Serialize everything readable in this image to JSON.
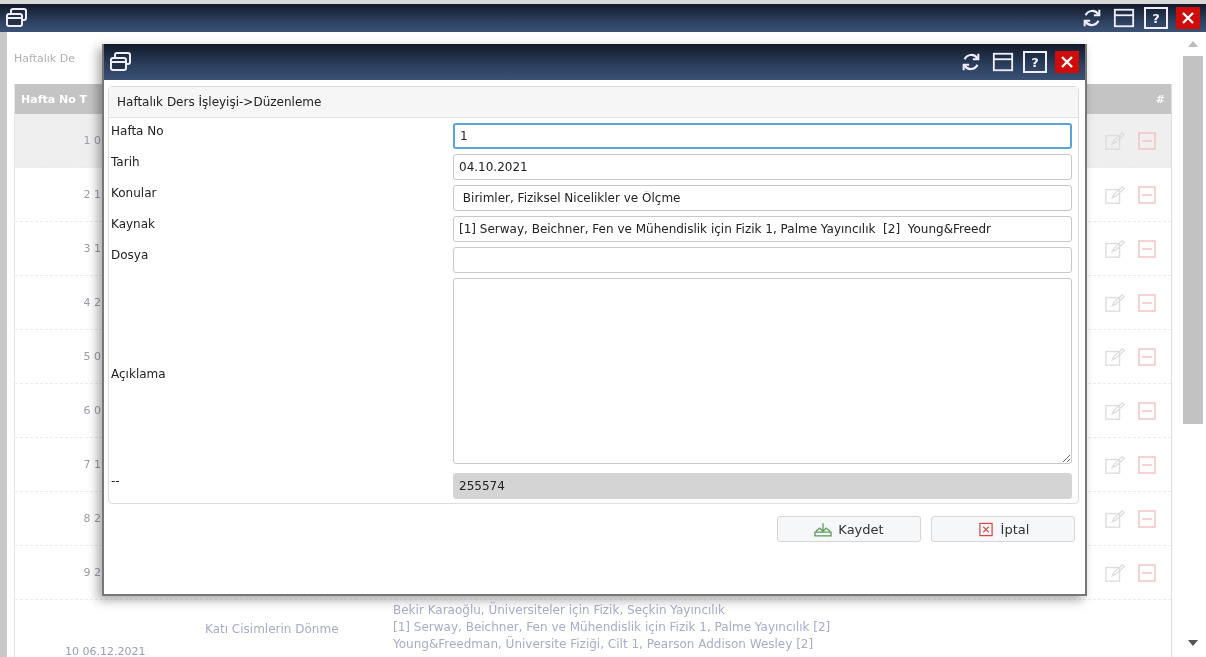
{
  "window": {
    "help_glyph": "?"
  },
  "page": {
    "title": "Haftalık De",
    "columns": [
      {
        "label": "Hafta No T"
      },
      {
        "label": "#"
      }
    ],
    "rows": [
      {
        "number": "1 0",
        "selected": true
      },
      {
        "number": "2 1",
        "selected": false
      },
      {
        "number": "3 1",
        "selected": false
      },
      {
        "number": "4 2",
        "selected": false
      },
      {
        "number": "5 0",
        "selected": false
      },
      {
        "number": "6 0",
        "selected": false
      },
      {
        "number": "7 1",
        "selected": false
      },
      {
        "number": "8 2",
        "selected": false
      },
      {
        "number": "9 2",
        "selected": false
      }
    ],
    "last_row": {
      "number": "10 06.12.2021",
      "topic": "Katı Cisimlerin Dönme",
      "source_lines": [
        "Bekir Karaoğlu, Üniversiteler için Fizik, Seçkin Yayıncılık",
        "[1] Serway, Beichner, Fen ve Mühendislik için Fizik 1, Palme Yayıncılık [2]",
        "Young&Freedman, Üniversite Fiziği, Cilt 1, Pearson Addison Wesley [2]"
      ]
    }
  },
  "dialog": {
    "help_glyph": "?",
    "heading": "Haftalık Ders İşleyişi->Düzenleme",
    "fields": [
      {
        "kind": "text",
        "label": "Hafta No",
        "value": "1",
        "focused": true,
        "disabled": false
      },
      {
        "kind": "text",
        "label": "Tarih",
        "value": "04.10.2021",
        "focused": false,
        "disabled": false
      },
      {
        "kind": "text",
        "label": "Konular",
        "value": " Birimler, Fiziksel Nicelikler ve Ölçme",
        "focused": false,
        "disabled": false
      },
      {
        "kind": "text",
        "label": "Kaynak",
        "value": "[1] Serway, Beichner, Fen ve Mühendislik için Fizik 1, Palme Yayıncılık  [2]  Young&Freedr",
        "focused": false,
        "disabled": false
      },
      {
        "kind": "text",
        "label": "Dosya",
        "focused": false,
        "disabled": false
      },
      {
        "kind": "textarea",
        "label": "Açıklama",
        "focused": false,
        "disabled": false
      },
      {
        "kind": "text",
        "label": "--",
        "value": "255574",
        "focused": false,
        "disabled": true
      }
    ],
    "buttons": [
      {
        "kind": "save",
        "label": "Kaydet"
      },
      {
        "kind": "cancel",
        "label": "İptal"
      }
    ]
  }
}
